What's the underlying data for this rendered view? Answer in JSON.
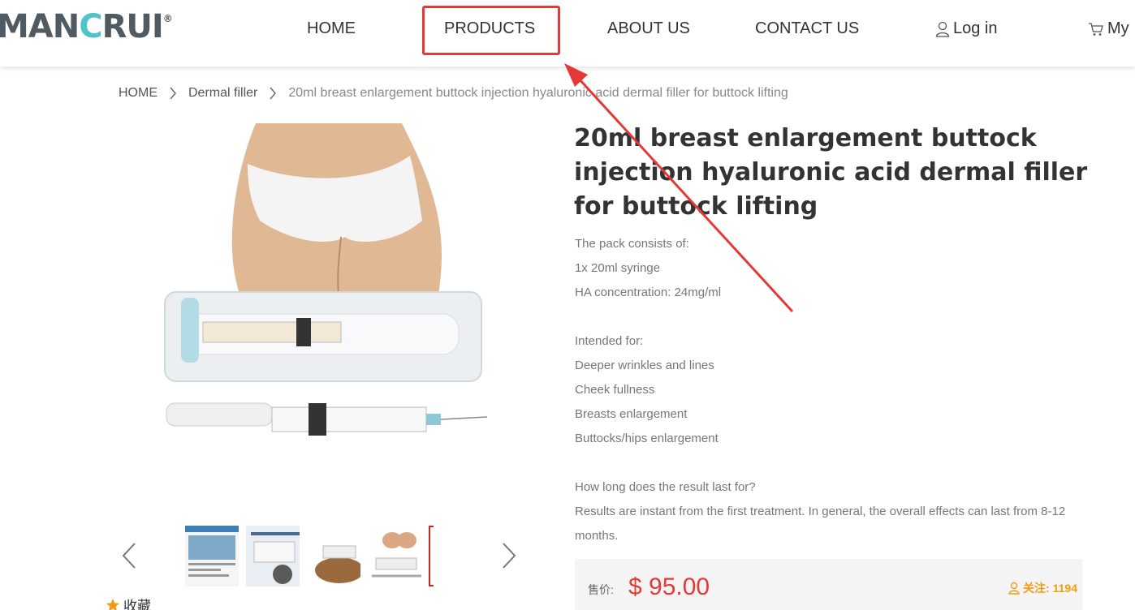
{
  "header": {
    "logo": "MANCRUI",
    "logo_mark": "®",
    "nav": {
      "home": "HOME",
      "products": "PRODUCTS",
      "about": "ABOUT US",
      "contact": "CONTACT US",
      "login": "Log in",
      "cart": "My"
    }
  },
  "breadcrumb": {
    "home": "HOME",
    "category": "Dermal filler",
    "current": "20ml breast enlargement buttock injection hyaluronic acid dermal filler for buttock lifting"
  },
  "product": {
    "title": "20ml breast enlargement buttock injection hyaluronic acid dermal filler for buttock lifting",
    "description": [
      "The pack consists of:",
      "1x 20ml syringe",
      "HA concentration: 24mg/ml",
      "",
      "Intended for:",
      "Deeper wrinkles and lines",
      "Cheek fullness",
      "Breasts enlargement",
      "Buttocks/hips enlargement",
      "",
      "How long does the result last for?",
      "Results are instant from the first treatment. In general, the overall effects can last from 8-12 months."
    ],
    "price_label": "售价:",
    "price": "$ 95.00",
    "follow_label": "关注:",
    "follow_count": "1194",
    "favorite": "收藏"
  },
  "colors": {
    "accent_red": "#e53935",
    "follow_orange": "#f39c12",
    "logo_teal": "#4fc3c7"
  }
}
